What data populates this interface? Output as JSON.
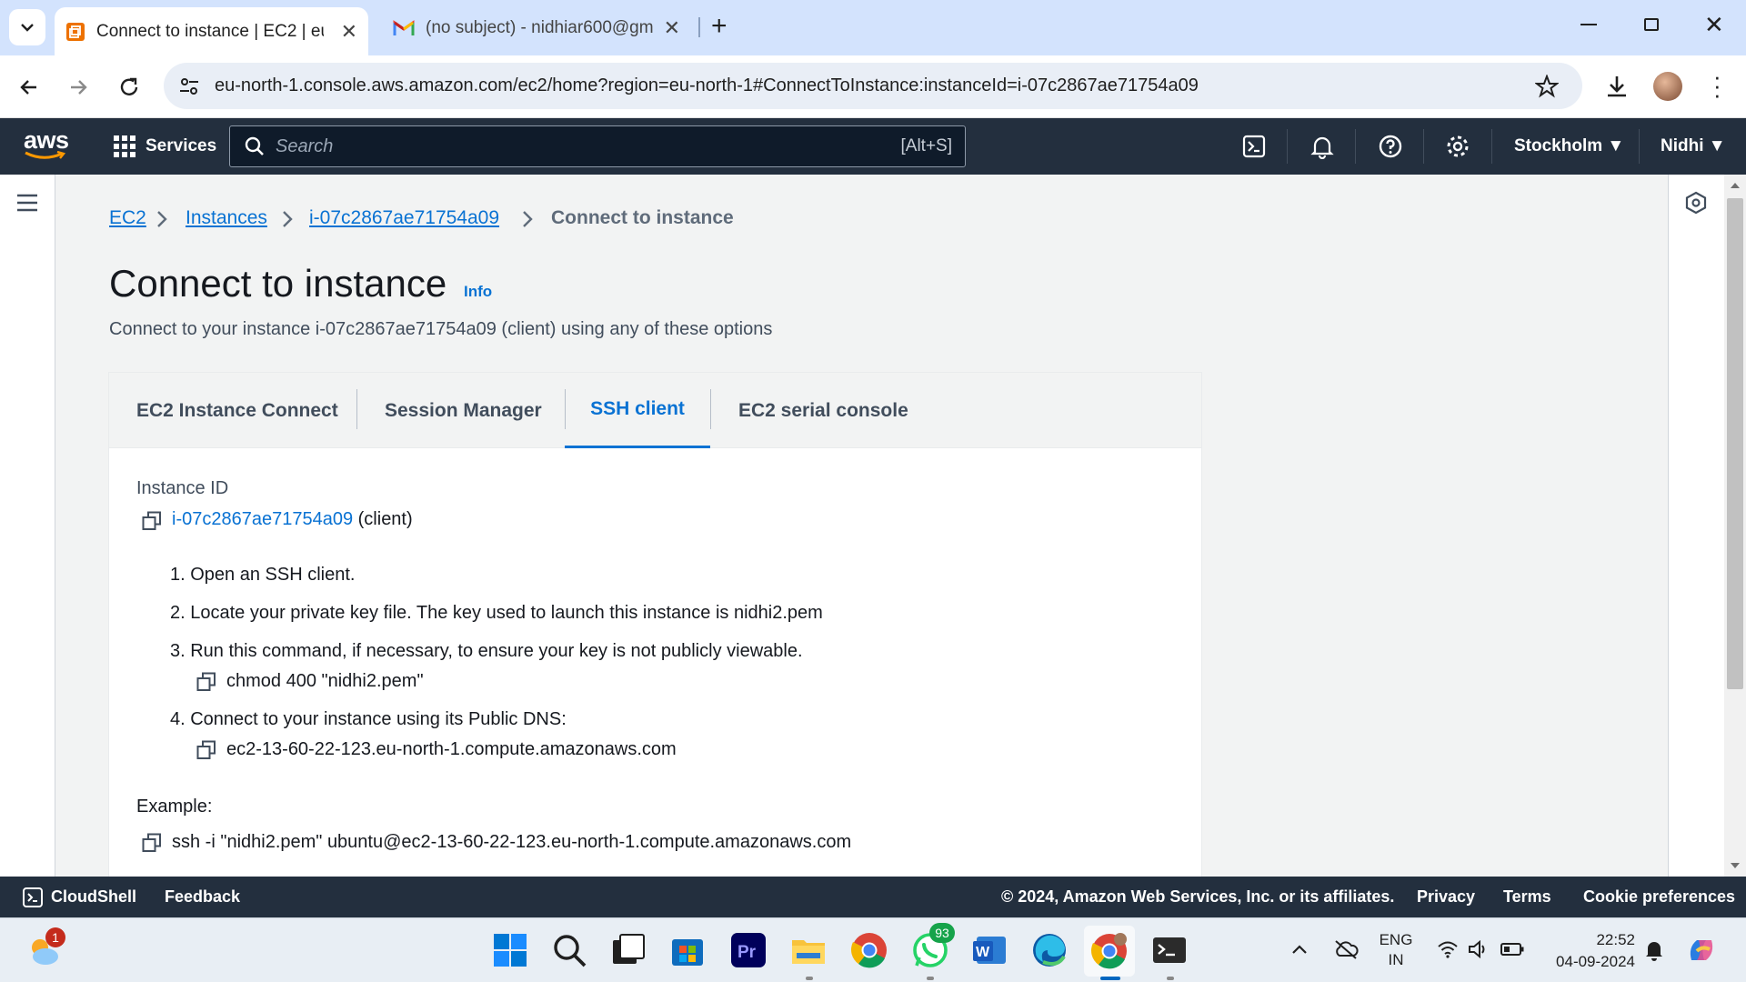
{
  "browser": {
    "tabs": [
      {
        "title": "Connect to instance | EC2 | eu-n",
        "active": true
      },
      {
        "title": "(no subject) - nidhiar600@gmail",
        "active": false
      }
    ],
    "url": "eu-north-1.console.aws.amazon.com/ec2/home?region=eu-north-1#ConnectToInstance:instanceId=i-07c2867ae71754a09"
  },
  "aws_nav": {
    "logo": "aws",
    "services_label": "Services",
    "search_placeholder": "Search",
    "search_shortcut": "[Alt+S]",
    "region": "Stockholm ▼",
    "user": "Nidhi ▼"
  },
  "breadcrumb": {
    "items": [
      "EC2",
      "Instances",
      "i-07c2867ae71754a09"
    ],
    "current": "Connect to instance"
  },
  "page": {
    "title": "Connect to instance",
    "info": "Info",
    "subtitle": "Connect to your instance i-07c2867ae71754a09 (client) using any of these options"
  },
  "tabs": [
    {
      "label": "EC2 Instance Connect",
      "selected": false
    },
    {
      "label": "Session Manager",
      "selected": false
    },
    {
      "label": "SSH client",
      "selected": true
    },
    {
      "label": "EC2 serial console",
      "selected": false
    }
  ],
  "ssh": {
    "instance_id_label": "Instance ID",
    "instance_id": "i-07c2867ae71754a09",
    "instance_suffix": "(client)",
    "steps": [
      "1. Open an SSH client.",
      "2. Locate your private key file. The key used to launch this instance is nidhi2.pem",
      "3. Run this command, if necessary, to ensure your key is not publicly viewable.",
      "4. Connect to your instance using its Public DNS:"
    ],
    "chmod_command": "chmod 400 \"nidhi2.pem\"",
    "public_dns": "ec2-13-60-22-123.eu-north-1.compute.amazonaws.com",
    "example_label": "Example:",
    "example_command": "ssh -i \"nidhi2.pem\" ubuntu@ec2-13-60-22-123.eu-north-1.compute.amazonaws.com"
  },
  "footer": {
    "cloudshell": "CloudShell",
    "feedback": "Feedback",
    "copyright": "© 2024, Amazon Web Services, Inc. or its affiliates.",
    "privacy": "Privacy",
    "terms": "Terms",
    "cookies": "Cookie preferences"
  },
  "taskbar": {
    "weather_badge": "1",
    "whatsapp_badge": "93",
    "lang_top": "ENG",
    "lang_bottom": "IN",
    "time": "22:52",
    "date": "04-09-2024"
  },
  "colors": {
    "aws_nav": "#232f3e",
    "aws_orange": "#ff9900",
    "link_blue": "#0972d3",
    "tab_strip": "#d3e3fd"
  }
}
